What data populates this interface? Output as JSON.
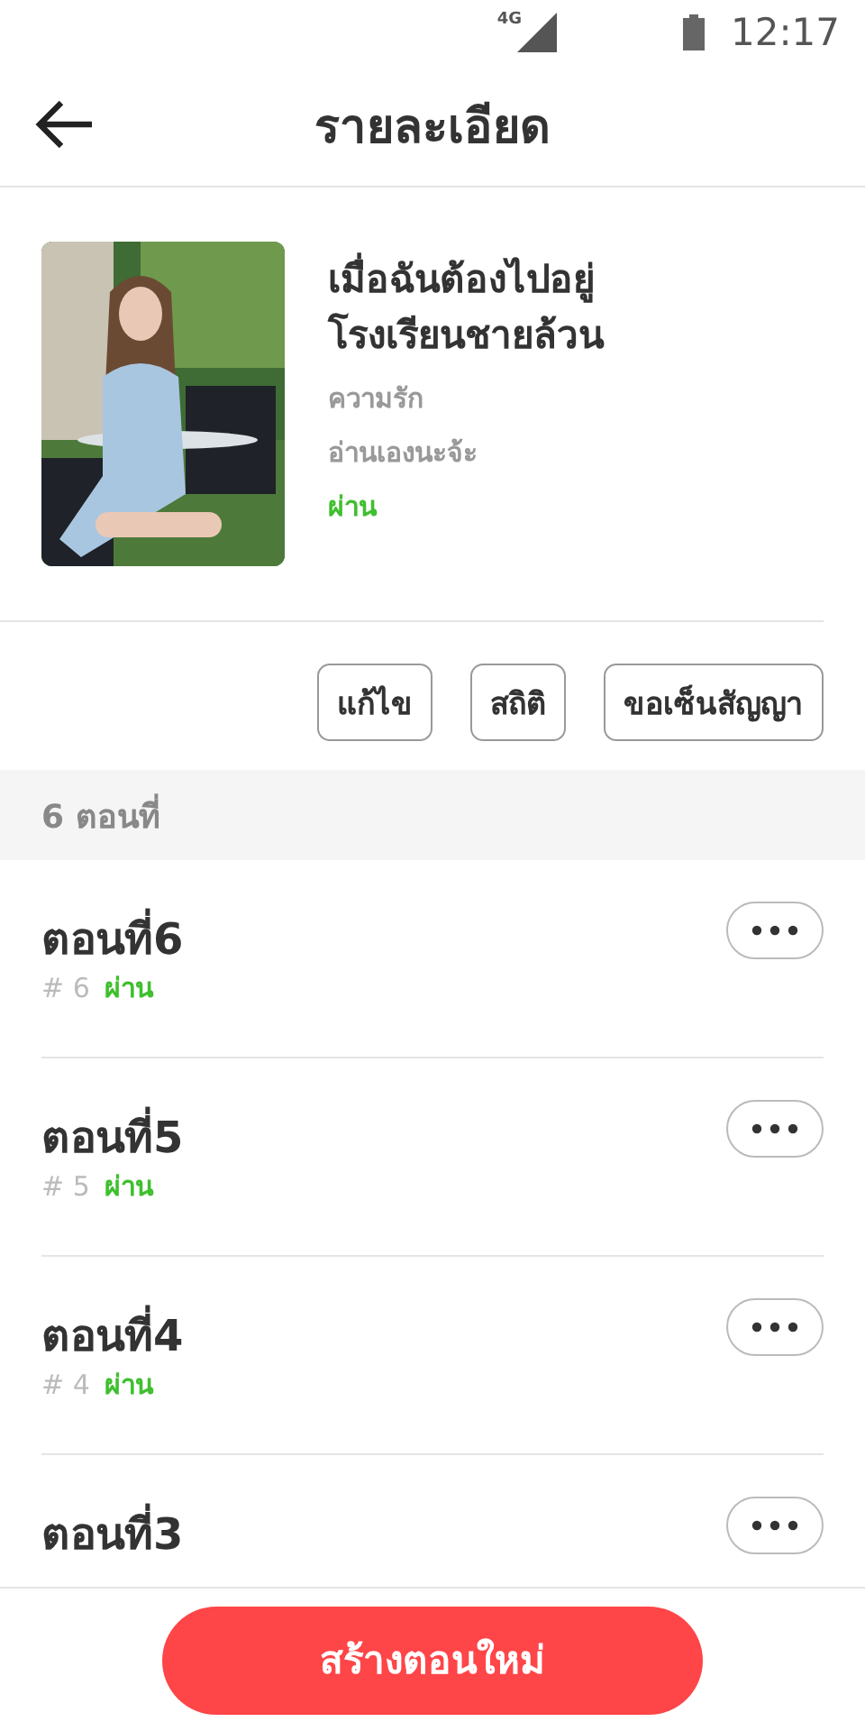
{
  "status_bar": {
    "network": "4G",
    "time": "12:17"
  },
  "header": {
    "title": "รายละเอียด"
  },
  "book": {
    "title": "เมื่อฉันต้องไปอยู่โรงเรียนชายล้วน",
    "category": "ความรัก",
    "tagline": "อ่านเองนะจ้ะ",
    "status": "ผ่าน"
  },
  "actions": [
    "แก้ไข",
    "สถิติ",
    "ขอเซ็นสัญญา"
  ],
  "section": {
    "label": "6 ตอนที่"
  },
  "episodes": [
    {
      "title": "ตอนที่6",
      "number": "# 6",
      "status": "ผ่าน"
    },
    {
      "title": "ตอนที่5",
      "number": "# 5",
      "status": "ผ่าน"
    },
    {
      "title": "ตอนที่4",
      "number": "# 4",
      "status": "ผ่าน"
    },
    {
      "title": "ตอนที่3"
    }
  ],
  "footer": {
    "button": "สร้างตอนใหม่"
  }
}
